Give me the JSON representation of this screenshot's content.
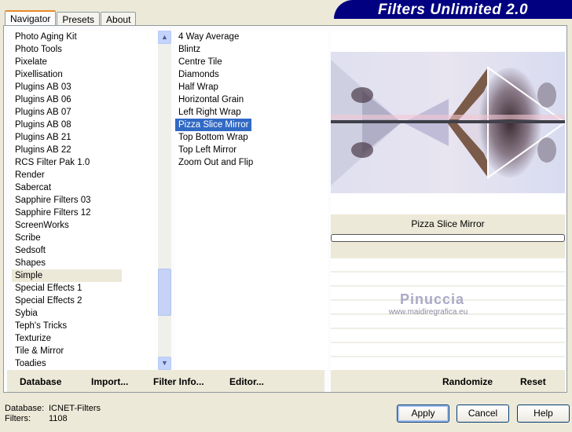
{
  "title": "Filters Unlimited 2.0",
  "tabs": [
    {
      "label": "Navigator",
      "active": true
    },
    {
      "label": "Presets"
    },
    {
      "label": "About"
    }
  ],
  "categories": [
    "Photo Aging Kit",
    "Photo Tools",
    "Pixelate",
    "Pixellisation",
    "Plugins AB 03",
    "Plugins AB 06",
    "Plugins AB 07",
    "Plugins AB 08",
    "Plugins AB 21",
    "Plugins AB 22",
    "RCS Filter Pak 1.0",
    "Render",
    "Sabercat",
    "Sapphire Filters 03",
    "Sapphire Filters 12",
    "ScreenWorks",
    "Scribe",
    "Sedsoft",
    "Shapes",
    "Simple",
    "Special Effects 1",
    "Special Effects 2",
    "Sybia",
    "Teph's Tricks",
    "Texturize",
    "Tile & Mirror",
    "Toadies"
  ],
  "selected_category": "Simple",
  "filters": [
    "4 Way Average",
    "Blintz",
    "Centre Tile",
    "Diamonds",
    "Half Wrap",
    "Horizontal Grain",
    "Left Right Wrap",
    "Pizza Slice Mirror",
    "Top Bottom Wrap",
    "Top Left Mirror",
    "Zoom Out and Flip"
  ],
  "selected_filter": "Pizza Slice Mirror",
  "preview": {
    "filter_name": "Pizza Slice Mirror",
    "progress": 0,
    "watermark": {
      "name": "Pinuccia",
      "url": "www.maidiregrafica.eu"
    }
  },
  "toolbar": {
    "database": "Database",
    "import": "Import...",
    "filter_info": "Filter Info...",
    "editor": "Editor...",
    "randomize": "Randomize",
    "reset": "Reset"
  },
  "footer": {
    "database_label": "Database:",
    "database_value": "ICNET-Filters",
    "filters_label": "Filters:",
    "filters_value": "1108"
  },
  "buttons": {
    "apply": "Apply",
    "cancel": "Cancel",
    "help": "Help"
  },
  "colors": {
    "banner": "#000080",
    "selection": "#316ac5",
    "tab_accent": "#e68b2c"
  }
}
